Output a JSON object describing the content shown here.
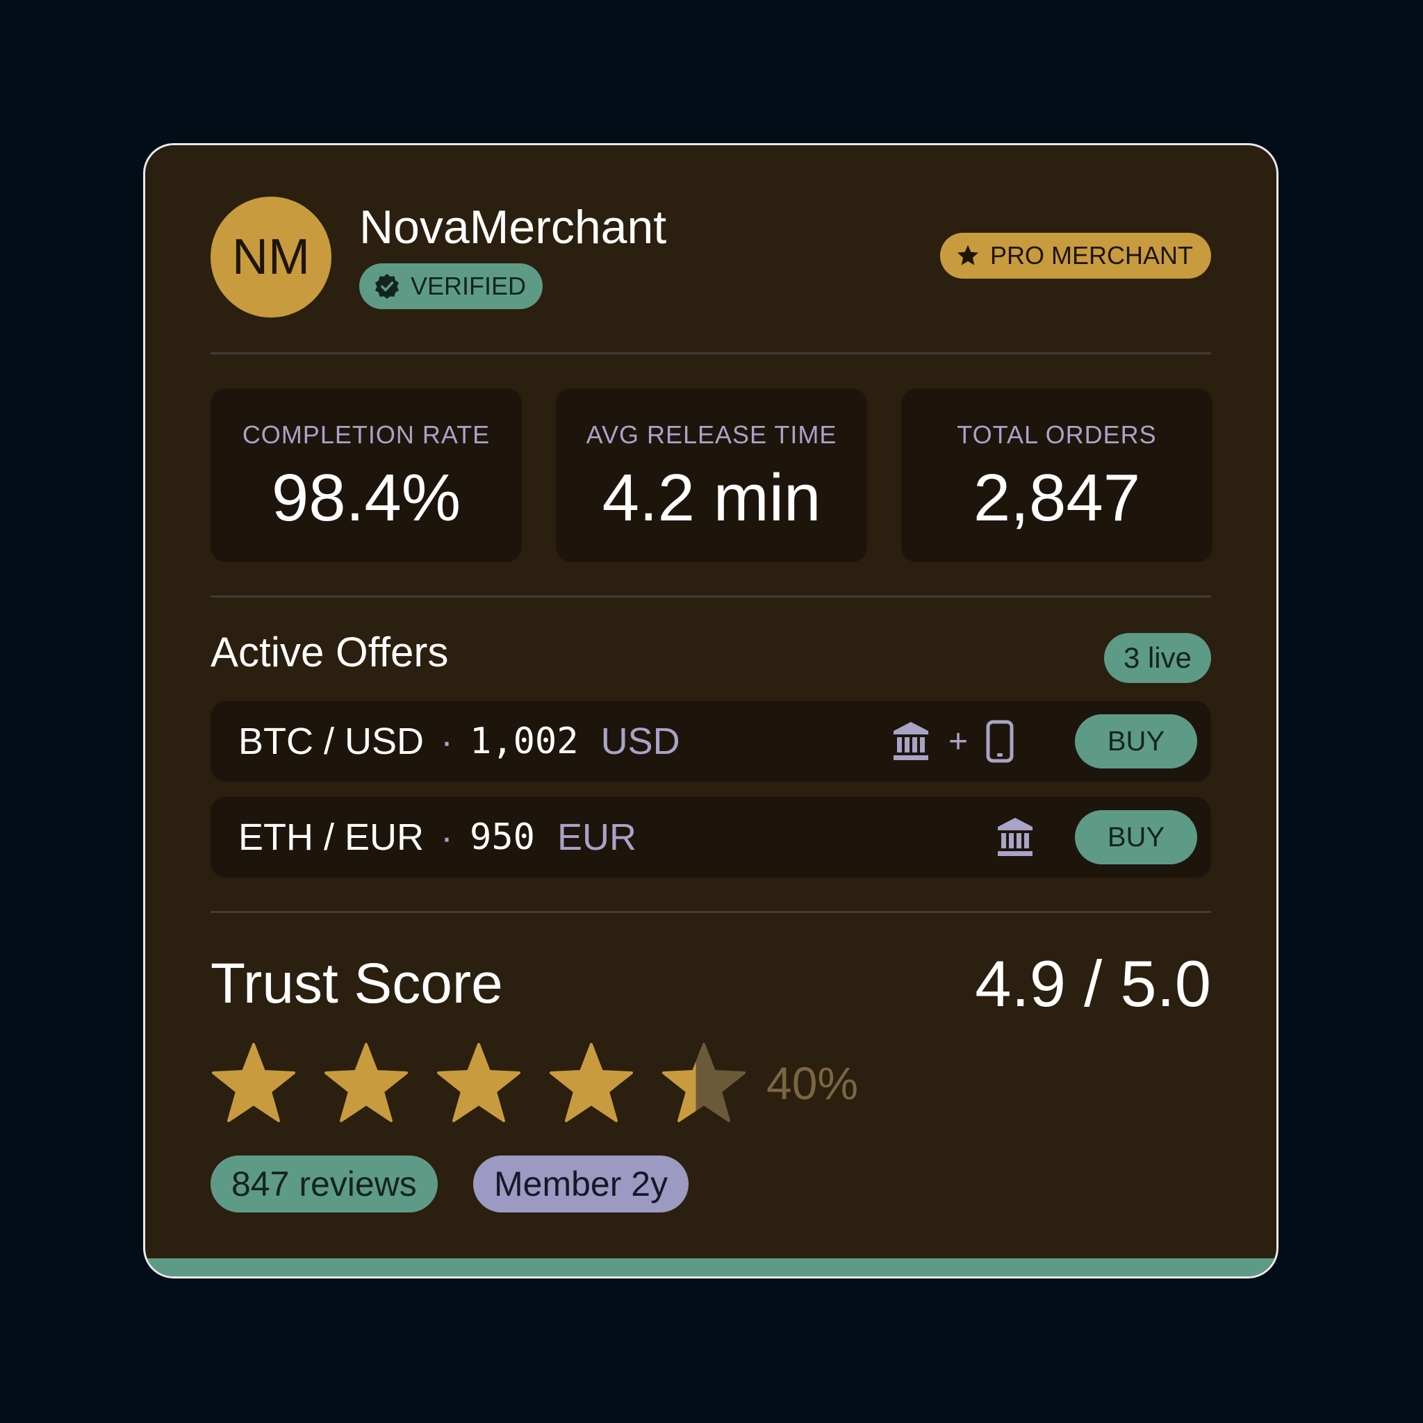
{
  "merchant": {
    "initials": "NM",
    "name": "NovaMerchant",
    "verified_label": "VERIFIED",
    "badge_label": "PRO MERCHANT"
  },
  "stats": [
    {
      "label": "COMPLETION RATE",
      "value": "98.4%"
    },
    {
      "label": "AVG RELEASE TIME",
      "value": "4.2 min"
    },
    {
      "label": "TOTAL ORDERS",
      "value": "2,847"
    }
  ],
  "offers_section": {
    "title": "Active Offers",
    "live_badge": "3 live",
    "offers": [
      {
        "pair": "BTC / USD",
        "separator": "·",
        "amount": "1,002",
        "currency": "USD",
        "methods": [
          "bank-icon",
          "mobile-phone-icon"
        ],
        "methods_joiner": "+",
        "action": "BUY"
      },
      {
        "pair": "ETH / EUR",
        "separator": "·",
        "amount": "950",
        "currency": "EUR",
        "methods": [
          "bank-icon"
        ],
        "action": "BUY"
      }
    ]
  },
  "trust": {
    "title": "Trust Score",
    "score": "4.9 / 5.0",
    "stars_full": 4,
    "partial_star_fill": 0.4,
    "partial_label": "40%",
    "reviews_chip": "847 reviews",
    "member_chip": "Member 2y"
  },
  "colors": {
    "background": "#020d17",
    "card": "#2b1f0f",
    "panel": "#1d150c",
    "gold": "#c99b3f",
    "teal": "#5e9b87",
    "lavender": "#9c9ac3"
  }
}
